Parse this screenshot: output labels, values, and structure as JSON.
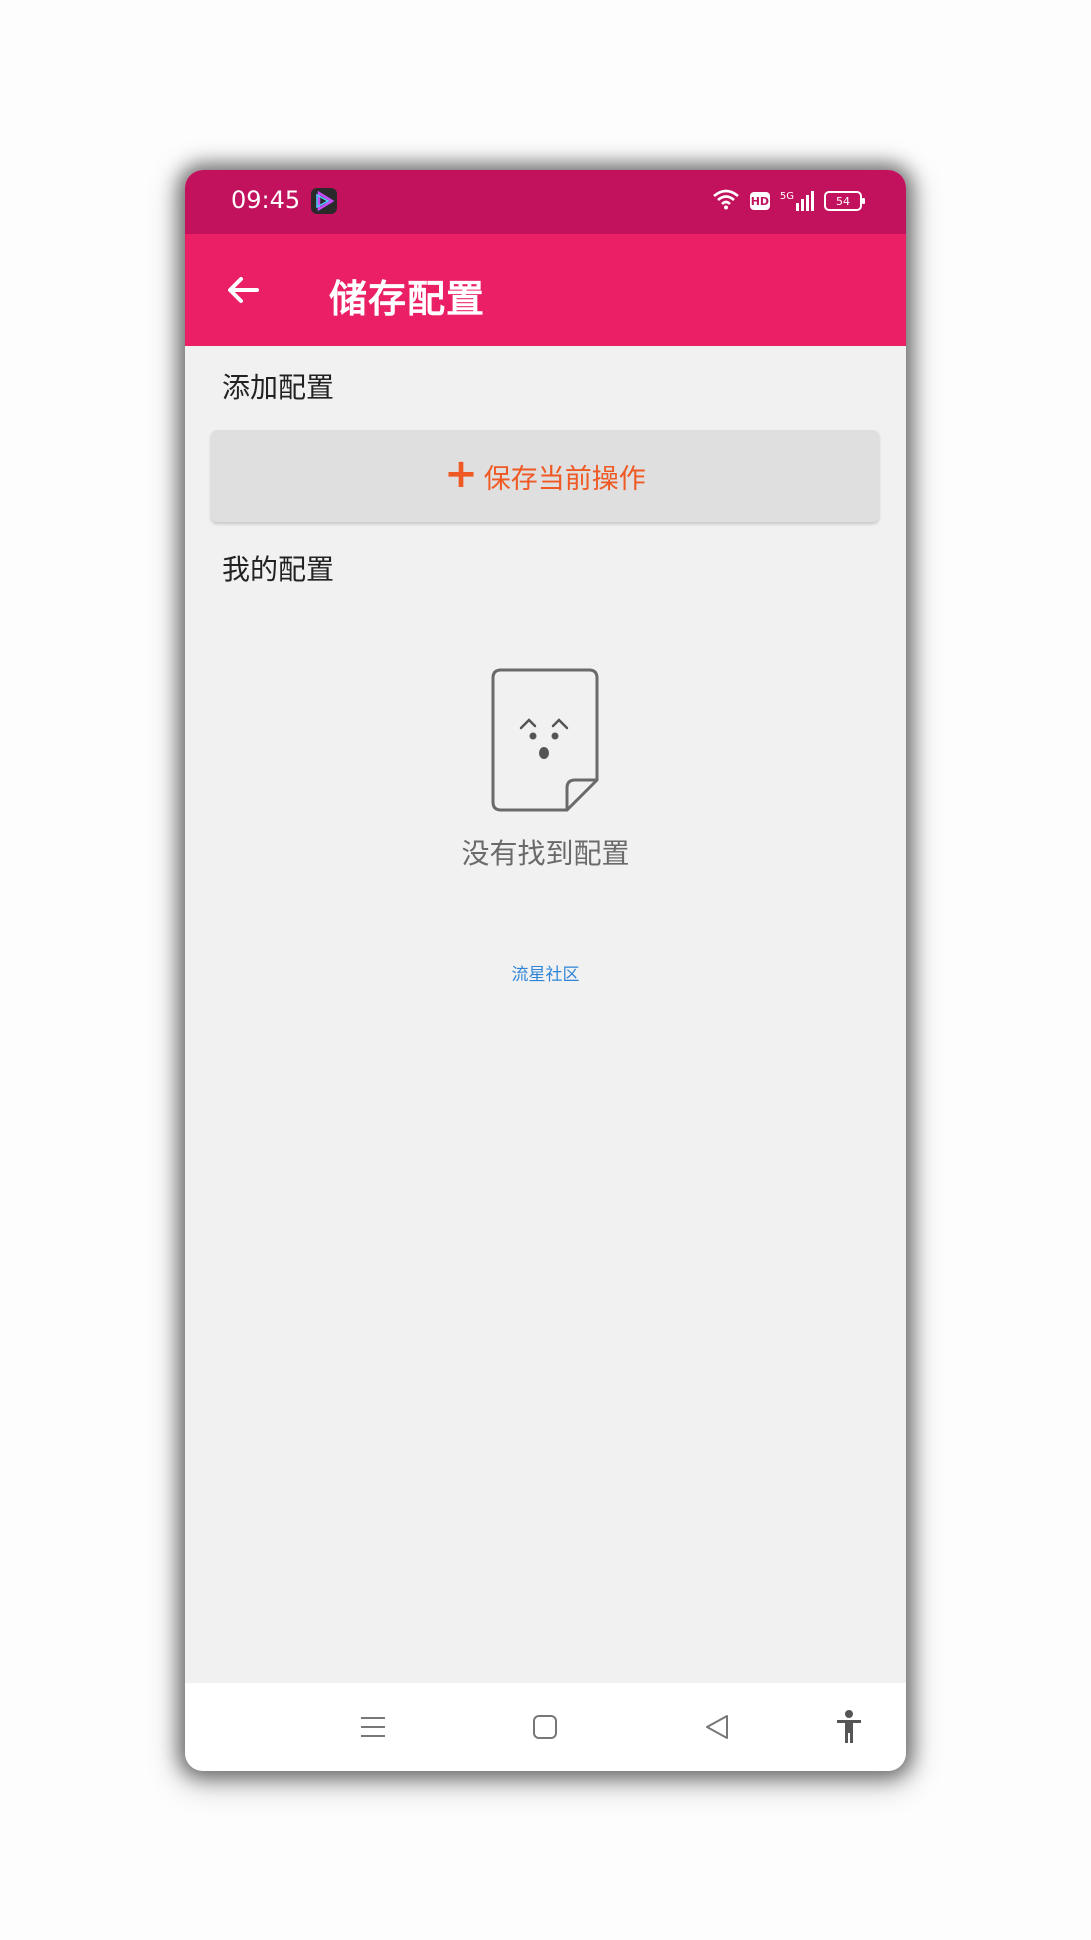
{
  "status_bar": {
    "time": "09:45",
    "network": "5G",
    "hd": "HD",
    "battery": "54"
  },
  "app_bar": {
    "title": "储存配置",
    "back_icon": "arrow-left-icon"
  },
  "add_section": {
    "header": "添加配置",
    "save_button_plus": "+",
    "save_button_label": "保存当前操作"
  },
  "my_section": {
    "header": "我的配置",
    "empty_icon": "empty-document-icon",
    "empty_text": "没有找到配置"
  },
  "footer": {
    "community_link": "流星社区"
  },
  "nav_bar": {
    "icons": [
      "menu-icon",
      "home-icon",
      "back-icon",
      "accessibility-icon"
    ]
  },
  "colors": {
    "status_bar": "#c2125e",
    "app_bar": "#ea1f65",
    "accent": "#ef5a24",
    "link": "#2f86d8",
    "background": "#f1f1f1"
  }
}
